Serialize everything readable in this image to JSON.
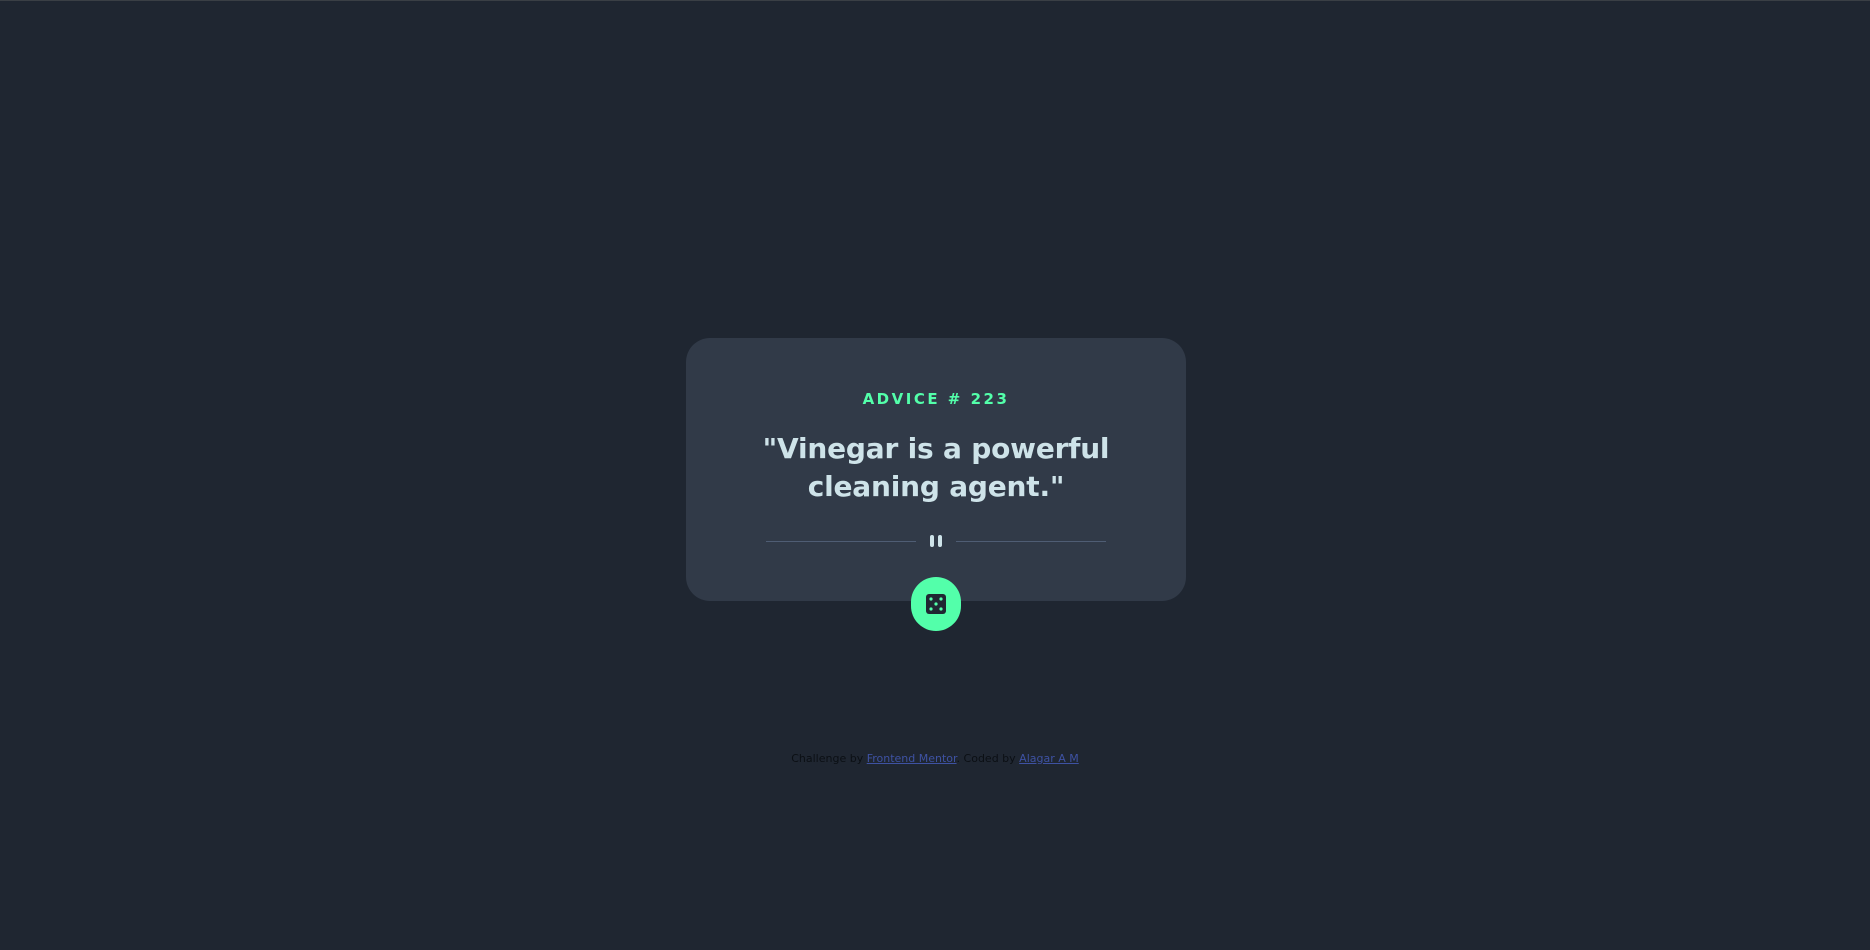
{
  "advice": {
    "heading": "ADVICE # 223",
    "quote": "\"Vinegar is a powerful cleaning agent.\""
  },
  "divider": {
    "icon": "pause-icon"
  },
  "dice_button": {
    "icon": "dice-icon"
  },
  "footer": {
    "challenge_prefix": "Challenge by",
    "challenge_link": "Frontend Mentor",
    "separator": ". Coded by",
    "author_link": "Alagar A M"
  },
  "colors": {
    "background": "#1f2631",
    "card": "#313a48",
    "accent": "#53ffaa",
    "quote_text": "#cee3e9",
    "divider": "#4f5d74",
    "link": "#3e52a3"
  }
}
